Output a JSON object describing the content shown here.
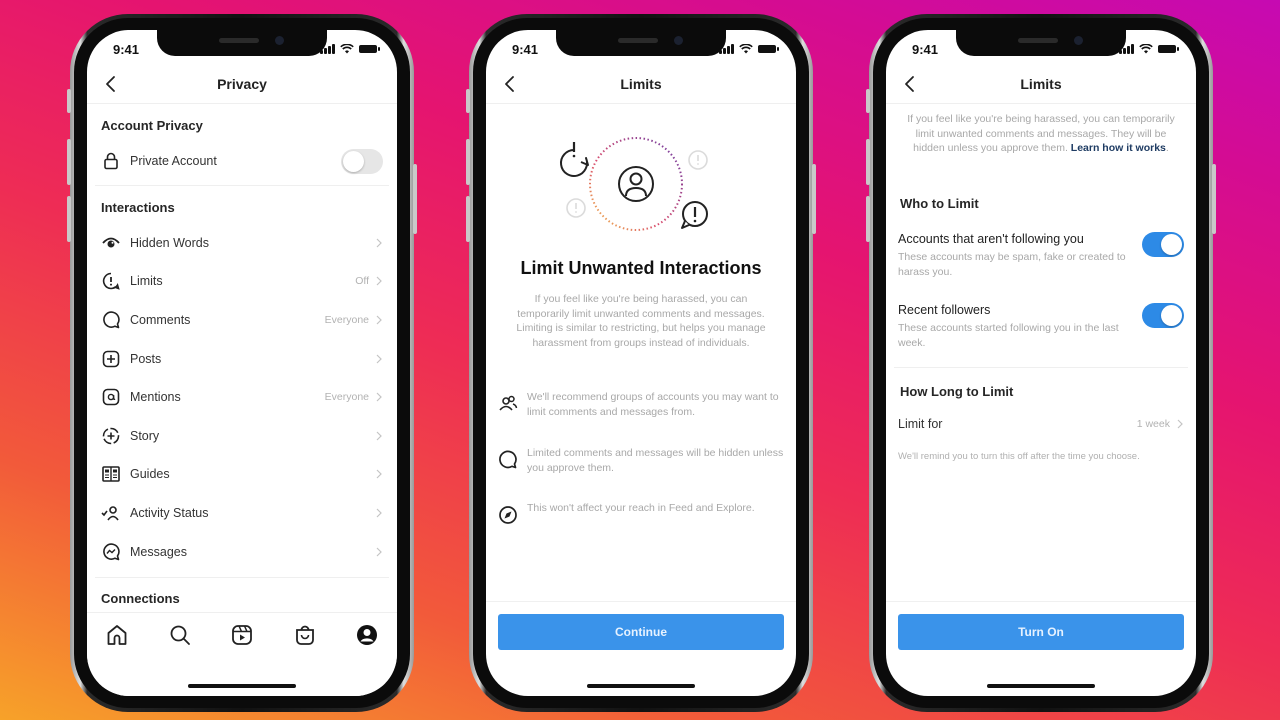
{
  "status_time": "9:41",
  "colors": {
    "accent_blue": "#3a93ea",
    "toggle_on": "#2d8ae6",
    "toggle_off": "#e6e6e6",
    "link": "#1f3c63"
  },
  "phones": [
    {
      "screen": "privacy",
      "title": "Privacy",
      "sections": [
        {
          "title": "Account Privacy",
          "rows": [
            {
              "icon": "lock-icon",
              "label": "Private Account",
              "control": "toggle",
              "toggle_on": false
            }
          ]
        },
        {
          "title": "Interactions",
          "rows": [
            {
              "icon": "eye-icon",
              "label": "Hidden Words",
              "value": ""
            },
            {
              "icon": "alert-bubble-icon",
              "label": "Limits",
              "value": "Off"
            },
            {
              "icon": "comment-icon",
              "label": "Comments",
              "value": "Everyone"
            },
            {
              "icon": "plus-square-icon",
              "label": "Posts",
              "value": ""
            },
            {
              "icon": "at-icon",
              "label": "Mentions",
              "value": "Everyone"
            },
            {
              "icon": "story-add-icon",
              "label": "Story",
              "value": ""
            },
            {
              "icon": "guides-icon",
              "label": "Guides",
              "value": ""
            },
            {
              "icon": "activity-status-icon",
              "label": "Activity Status",
              "value": ""
            },
            {
              "icon": "messenger-icon",
              "label": "Messages",
              "value": ""
            }
          ]
        },
        {
          "title": "Connections",
          "rows": []
        }
      ],
      "tab_bar": [
        "home-icon",
        "search-icon",
        "reels-icon",
        "shop-icon",
        "profile-icon"
      ]
    },
    {
      "screen": "limits-intro",
      "title": "Limits",
      "heading": "Limit Unwanted Interactions",
      "description": "If you feel like you're being harassed, you can temporarily limit unwanted comments and messages. Limiting is similar to restricting, but helps you manage harassment from groups instead of individuals.",
      "features": [
        {
          "icon": "people-icon",
          "text": "We'll recommend groups of accounts you may want to limit comments and messages from."
        },
        {
          "icon": "comment-icon",
          "text": "Limited comments and messages will be hidden unless you approve them."
        },
        {
          "icon": "compass-icon",
          "text": "This won't affect your reach in Feed and Explore."
        }
      ],
      "button": "Continue"
    },
    {
      "screen": "limits-settings",
      "title": "Limits",
      "description": "If you feel like you're being harassed, you can temporarily limit unwanted comments and messages. They will be hidden unless you approve them.",
      "learn_link": "Learn how it works",
      "who_title": "Who to Limit",
      "who_options": [
        {
          "label": "Accounts that aren't following you",
          "sub": "These accounts may be spam, fake or created to harass you.",
          "toggle_on": true
        },
        {
          "label": "Recent followers",
          "sub": "These accounts started following you in the last week.",
          "toggle_on": true
        }
      ],
      "how_long_title": "How Long to Limit",
      "limit_for_label": "Limit for",
      "limit_for_value": "1 week",
      "reminder": "We'll remind you to turn this off after the time you choose.",
      "button": "Turn On"
    }
  ]
}
